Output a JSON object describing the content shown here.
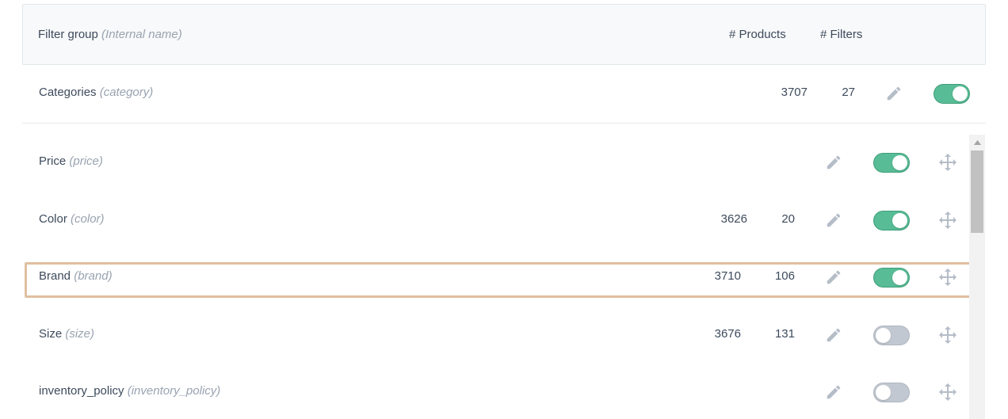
{
  "header": {
    "title": "Filter group",
    "title_hint": "(Internal name)",
    "col_products": "# Products",
    "col_filters": "# Filters"
  },
  "category_row": {
    "name": "Categories",
    "internal": "(category)",
    "products": "3707",
    "filters": "27",
    "enabled": true,
    "edit_icon": "pencil-icon"
  },
  "rows": [
    {
      "name": "Price",
      "internal": "(price)",
      "products": "",
      "filters": "",
      "enabled": true
    },
    {
      "name": "Color",
      "internal": "(color)",
      "products": "3626",
      "filters": "20",
      "enabled": true
    },
    {
      "name": "Brand",
      "internal": "(brand)",
      "products": "3710",
      "filters": "106",
      "enabled": true,
      "highlighted": true
    },
    {
      "name": "Size",
      "internal": "(size)",
      "products": "3676",
      "filters": "131",
      "enabled": false
    },
    {
      "name": "inventory_policy",
      "internal": "(inventory_policy)",
      "products": "",
      "filters": "",
      "enabled": false
    }
  ],
  "icons": {
    "edit": "pencil-icon",
    "move": "move-arrows-icon",
    "scroll_up": "scroll-up-arrow-icon"
  },
  "colors": {
    "toggle_on": "#58bd96",
    "toggle_off": "#c2c8d1",
    "icon": "#b5bdc8",
    "highlight_border": "#e0bfa0",
    "muted_text": "#98a3b0"
  }
}
